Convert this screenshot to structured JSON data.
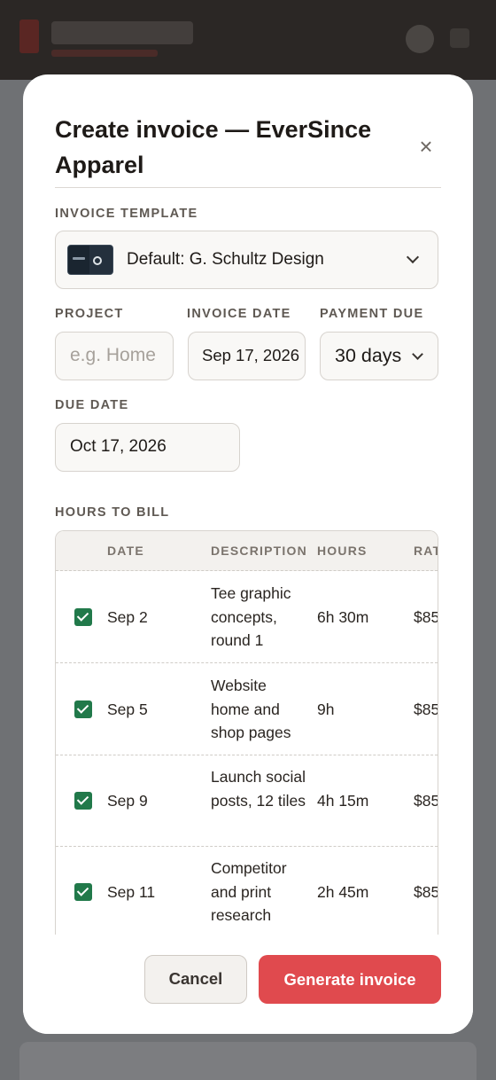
{
  "modal": {
    "title": "Create invoice — EverSince Apparel",
    "close_glyph": "×",
    "close_icon": "close-icon"
  },
  "template": {
    "label": "INVOICE TEMPLATE",
    "value": "Default: G. Schultz Design",
    "icon": "chevron-down-icon"
  },
  "project": {
    "label": "PROJECT",
    "placeholder": "e.g. Home"
  },
  "invoice_date": {
    "label": "INVOICE DATE",
    "value": "Sep 17, 2026"
  },
  "payment_due": {
    "label": "PAYMENT DUE",
    "value": "30 days"
  },
  "due_date": {
    "label": "DUE DATE",
    "value": "Oct 17, 2026"
  },
  "hours": {
    "label": "HOURS TO BILL",
    "columns": [
      "DATE",
      "DESCRIPTION",
      "HOURS",
      "RATE"
    ],
    "rows": [
      {
        "checked": true,
        "date": "Sep 2",
        "description": "Tee graphic concepts, round 1",
        "hours": "6h 30m",
        "rate": "$85"
      },
      {
        "checked": true,
        "date": "Sep 5",
        "description": "Website home and shop pages",
        "hours": "9h",
        "rate": "$85"
      },
      {
        "checked": true,
        "date": "Sep 9",
        "description": "Launch social posts, 12 tiles",
        "hours": "4h 15m",
        "rate": "$85"
      },
      {
        "checked": true,
        "date": "Sep 11",
        "description": "Competitor and print research",
        "hours": "2h 45m",
        "rate": "$85"
      }
    ]
  },
  "actions": {
    "cancel": "Cancel",
    "generate": "Generate invoice"
  },
  "colors": {
    "accent": "#e04a4e",
    "checkbox": "#21794a",
    "overlay": "#6b6d70"
  }
}
